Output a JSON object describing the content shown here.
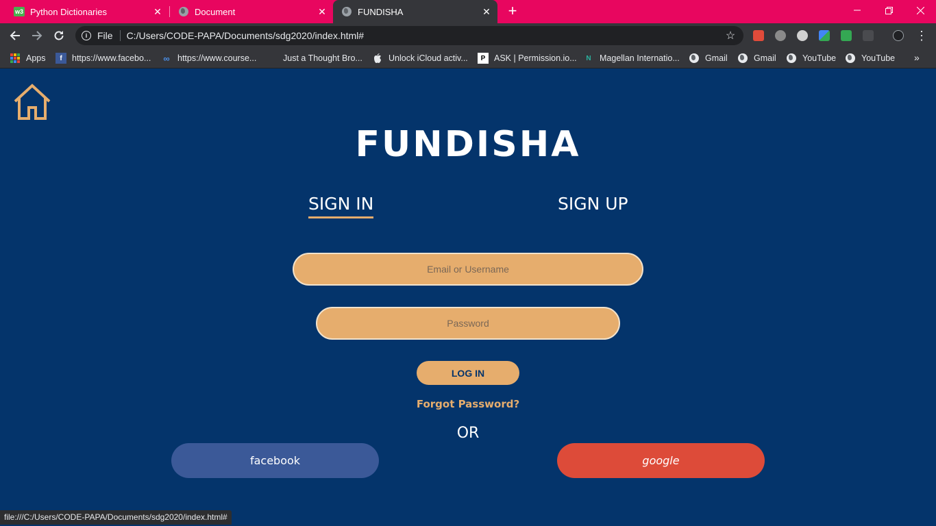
{
  "browser": {
    "tabs": [
      {
        "title": "Python Dictionaries",
        "favicon": "w3schools-icon"
      },
      {
        "title": "Document",
        "favicon": "globe-icon"
      },
      {
        "title": "FUNDISHA",
        "favicon": "globe-icon",
        "active": true
      }
    ],
    "address": {
      "scheme_label": "File",
      "url": "C:/Users/CODE-PAPA/Documents/sdg2020/index.html#"
    },
    "bookmarks": [
      {
        "label": "Apps",
        "icon": "apps-grid-icon"
      },
      {
        "label": "https://www.facebo...",
        "icon": "facebook-icon"
      },
      {
        "label": "https://www.course...",
        "icon": "coursera-icon"
      },
      {
        "label": "Just a Thought Bro...",
        "icon": "blank-page-icon"
      },
      {
        "label": "Unlock iCloud activ...",
        "icon": "apple-icon"
      },
      {
        "label": "ASK | Permission.io...",
        "icon": "permission-p-icon"
      },
      {
        "label": "Magellan Internatio...",
        "icon": "magellan-icon"
      },
      {
        "label": "Gmail",
        "icon": "globe-icon"
      },
      {
        "label": "Gmail",
        "icon": "globe-icon"
      },
      {
        "label": "YouTube",
        "icon": "globe-icon"
      },
      {
        "label": "YouTube",
        "icon": "globe-icon"
      }
    ],
    "status_url": "file:///C:/Users/CODE-PAPA/Documents/sdg2020/index.html#",
    "colors": {
      "tabstrip": "#e8065f",
      "toolbar": "#35363a"
    }
  },
  "page": {
    "brand": "FUNDISHA",
    "tabs": {
      "signin": "SIGN IN",
      "signup": "SIGN UP"
    },
    "form": {
      "email_placeholder": "Email or Username",
      "password_placeholder": "Password",
      "login_label": "LOG IN",
      "forgot_label": "Forgot Password?"
    },
    "or_label": "OR",
    "social": {
      "facebook": "facebook",
      "google": "google"
    },
    "colors": {
      "background": "#04346b",
      "accent": "#e6ad6d",
      "facebook": "#3b5998",
      "google": "#dd4b39"
    }
  }
}
